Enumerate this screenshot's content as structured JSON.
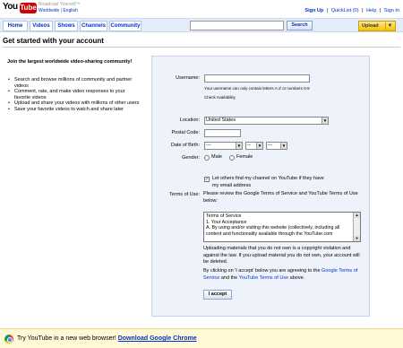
{
  "header": {
    "logo_you": "You",
    "logo_tube": "Tube",
    "tagline": "Broadcast Yourself",
    "tm": "™",
    "locale_worldwide": "Worldwide",
    "locale_sep": "|",
    "locale_language": "English",
    "links": {
      "signup": "Sign Up",
      "quicklist": "QuickList (0)",
      "help": "Help",
      "signin": "Sign In",
      "sep": "|"
    }
  },
  "nav": {
    "tabs": [
      "Home",
      "Videos",
      "Shows",
      "Channels",
      "Community"
    ],
    "search_value": "",
    "search_label": "Search",
    "upload_label": "Upload",
    "upload_arrow": "▼"
  },
  "page": {
    "title": "Get started with your account"
  },
  "intro": {
    "heading": "Join the largest worldwide video-sharing community!",
    "features": [
      "Search and browse millions of community and partner videos",
      "Comment, rate, and make video responses to your favorite videos",
      "Upload and share your videos with millions of other users",
      "Save your favorite videos to watch and share later"
    ]
  },
  "form": {
    "username_label": "Username:",
    "username_value": "",
    "username_note": "Your username can only contain letters A-Z or numbers 0-9",
    "check_availability": "Check Availability",
    "location_label": "Location:",
    "location_value": "United States",
    "postal_label": "Postal Code:",
    "postal_value": "",
    "dob_label": "Date of Birth:",
    "dob_month": "---",
    "dob_day": "--",
    "dob_year": "---",
    "gender_label": "Gender:",
    "gender_male": "Male",
    "gender_female": "Female",
    "find_channel_text": "Let others find my channel on YouTube if they have my email address",
    "find_channel_checked": true,
    "check_mark": "✓",
    "terms_label": "Terms of Use:",
    "terms_intro": "Please review the Google Terms of Service and YouTube Terms of Use below:",
    "tos_lines": [
      "Terms of Service",
      "1. Your Acceptance",
      "A. By using and/or visiting this website (collectively, including all",
      "content and functionality available through the YouTube.com"
    ],
    "tos_up": "▲",
    "tos_down": "▼",
    "copyright_note": "Uploading materials that you do not own is a copyright violation and against the law. If you upload material you do not own, your account will be deleted.",
    "agree_pre": "By clicking on 'I accept' below you are agreeing to the",
    "agree_link1": "Google Terms of Service",
    "agree_mid": "and the",
    "agree_link2": "YouTube Terms of Use",
    "agree_post": "above.",
    "accept_label": "I accept"
  },
  "chrome_promo": {
    "text": "Try YouTube in a new web browser!",
    "link": "Download Google Chrome"
  }
}
